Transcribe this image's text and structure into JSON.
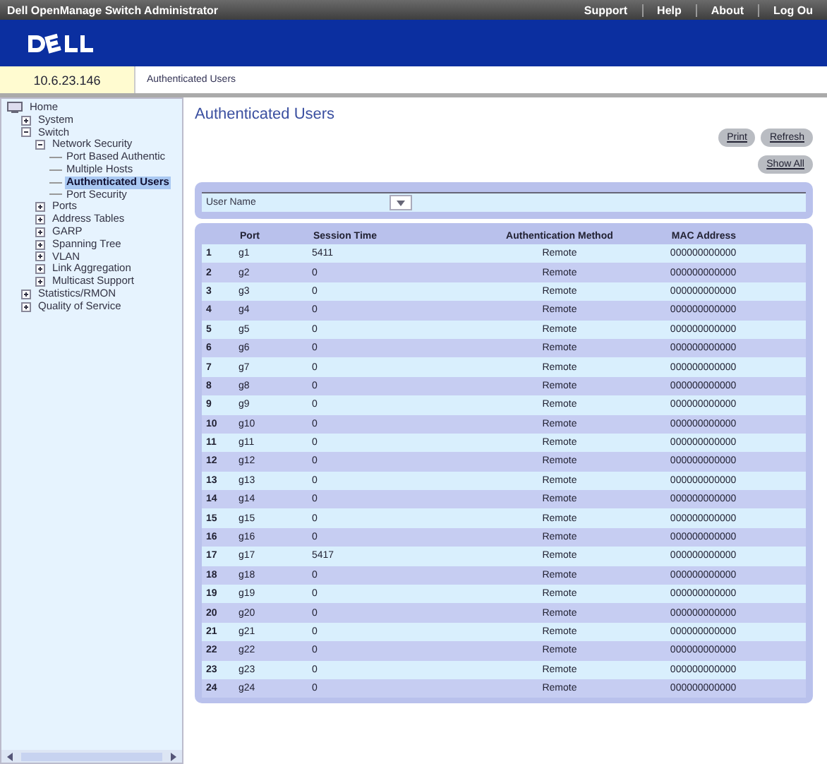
{
  "top_bar": {
    "title": "Dell OpenManage Switch Administrator",
    "links": [
      "Support",
      "Help",
      "About",
      "Log Ou"
    ]
  },
  "address": "10.6.23.146",
  "breadcrumb": "Authenticated Users",
  "tree": [
    {
      "label": "Home",
      "kind": "root",
      "selected": false,
      "children": [
        {
          "label": "System",
          "expanded": false,
          "selected": false
        },
        {
          "label": "Switch",
          "expanded": true,
          "selected": false,
          "children": [
            {
              "label": "Network Security",
              "expanded": true,
              "selected": false,
              "children": [
                {
                  "label": "Port Based Authentic",
                  "selected": false
                },
                {
                  "label": "Multiple Hosts",
                  "selected": false
                },
                {
                  "label": "Authenticated Users",
                  "selected": true
                },
                {
                  "label": "Port Security",
                  "selected": false
                }
              ]
            },
            {
              "label": "Ports",
              "expanded": false,
              "selected": false
            },
            {
              "label": "Address Tables",
              "expanded": false,
              "selected": false
            },
            {
              "label": "GARP",
              "expanded": false,
              "selected": false
            },
            {
              "label": "Spanning Tree",
              "expanded": false,
              "selected": false
            },
            {
              "label": "VLAN",
              "expanded": false,
              "selected": false
            },
            {
              "label": "Link Aggregation",
              "expanded": false,
              "selected": false
            },
            {
              "label": "Multicast Support",
              "expanded": false,
              "selected": false
            }
          ]
        },
        {
          "label": "Statistics/RMON",
          "expanded": false,
          "selected": false
        },
        {
          "label": "Quality of Service",
          "expanded": false,
          "selected": false
        }
      ]
    }
  ],
  "page_title": "Authenticated Users",
  "buttons": [
    "Print",
    "Refresh"
  ],
  "show_all_button": "Show All",
  "filter": {
    "label": "User Name"
  },
  "table": {
    "columns": [
      "",
      "Port",
      "Session Time",
      "Authentication Method",
      "MAC Address"
    ],
    "rows": [
      [
        "1",
        "g1",
        "5411",
        "Remote",
        "000000000000"
      ],
      [
        "2",
        "g2",
        "0",
        "Remote",
        "000000000000"
      ],
      [
        "3",
        "g3",
        "0",
        "Remote",
        "000000000000"
      ],
      [
        "4",
        "g4",
        "0",
        "Remote",
        "000000000000"
      ],
      [
        "5",
        "g5",
        "0",
        "Remote",
        "000000000000"
      ],
      [
        "6",
        "g6",
        "0",
        "Remote",
        "000000000000"
      ],
      [
        "7",
        "g7",
        "0",
        "Remote",
        "000000000000"
      ],
      [
        "8",
        "g8",
        "0",
        "Remote",
        "000000000000"
      ],
      [
        "9",
        "g9",
        "0",
        "Remote",
        "000000000000"
      ],
      [
        "10",
        "g10",
        "0",
        "Remote",
        "000000000000"
      ],
      [
        "11",
        "g11",
        "0",
        "Remote",
        "000000000000"
      ],
      [
        "12",
        "g12",
        "0",
        "Remote",
        "000000000000"
      ],
      [
        "13",
        "g13",
        "0",
        "Remote",
        "000000000000"
      ],
      [
        "14",
        "g14",
        "0",
        "Remote",
        "000000000000"
      ],
      [
        "15",
        "g15",
        "0",
        "Remote",
        "000000000000"
      ],
      [
        "16",
        "g16",
        "0",
        "Remote",
        "000000000000"
      ],
      [
        "17",
        "g17",
        "5417",
        "Remote",
        "000000000000"
      ],
      [
        "18",
        "g18",
        "0",
        "Remote",
        "000000000000"
      ],
      [
        "19",
        "g19",
        "0",
        "Remote",
        "000000000000"
      ],
      [
        "20",
        "g20",
        "0",
        "Remote",
        "000000000000"
      ],
      [
        "21",
        "g21",
        "0",
        "Remote",
        "000000000000"
      ],
      [
        "22",
        "g22",
        "0",
        "Remote",
        "000000000000"
      ],
      [
        "23",
        "g23",
        "0",
        "Remote",
        "000000000000"
      ],
      [
        "24",
        "g24",
        "0",
        "Remote",
        "000000000000"
      ]
    ]
  }
}
